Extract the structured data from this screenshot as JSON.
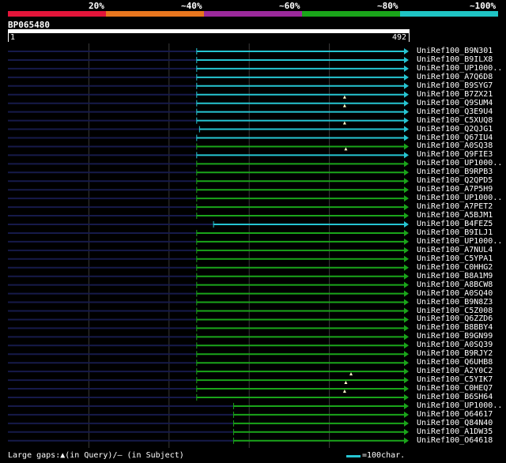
{
  "header": {
    "percent_labels": [
      "20%",
      "~40%",
      "~60%",
      "~80%",
      "~100%"
    ],
    "band_colors": [
      "#e3153a",
      "#e8761e",
      "#9c2a9c",
      "#1aa51a",
      "#1fc4c4"
    ]
  },
  "query": {
    "name": "BP065480",
    "start": "1",
    "end": "492"
  },
  "footer": {
    "gaps_text": "Large gaps:▲(in Query)/— (in Subject)",
    "scale_text": "=100char."
  },
  "colors": {
    "identity_high": "#26c5d2",
    "identity_med": "#1aa51a",
    "unaligned": "#161a4a",
    "grid": "#3a3a3a"
  },
  "hits": [
    {
      "id": "UniRef100_B9N301",
      "start": 0.471,
      "color": "cyan",
      "gap": null
    },
    {
      "id": "UniRef100_B9ILX8",
      "start": 0.471,
      "color": "cyan",
      "gap": null
    },
    {
      "id": "UniRef100_UP1000..",
      "start": 0.471,
      "color": "cyan",
      "gap": null
    },
    {
      "id": "UniRef100_A7Q6D8",
      "start": 0.471,
      "color": "cyan",
      "gap": null
    },
    {
      "id": "UniRef100_B9SYG7",
      "start": 0.471,
      "color": "cyan",
      "gap": null
    },
    {
      "id": "UniRef100_B7ZX21",
      "start": 0.471,
      "color": "cyan",
      "gap": null
    },
    {
      "id": "UniRef100_Q9SUM4",
      "start": 0.471,
      "color": "cyan",
      "gap": 0.84
    },
    {
      "id": "UniRef100_Q3E9U4",
      "start": 0.471,
      "color": "cyan",
      "gap": 0.84
    },
    {
      "id": "UniRef100_C5XUQ8",
      "start": 0.471,
      "color": "cyan",
      "gap": null
    },
    {
      "id": "UniRef100_Q2QJG1",
      "start": 0.478,
      "color": "cyan",
      "gap": 0.84
    },
    {
      "id": "UniRef100_Q67IU4",
      "start": 0.471,
      "color": "cyan",
      "gap": null
    },
    {
      "id": "UniRef100_A0SQ38",
      "start": 0.471,
      "color": "green",
      "gap": null
    },
    {
      "id": "UniRef100_Q9FIE3",
      "start": 0.471,
      "color": "cyan",
      "gap": 0.843
    },
    {
      "id": "UniRef100_UP1000..",
      "start": 0.471,
      "color": "green",
      "gap": null
    },
    {
      "id": "UniRef100_B9RPB3",
      "start": 0.471,
      "color": "green",
      "gap": null
    },
    {
      "id": "UniRef100_Q2QPD5",
      "start": 0.471,
      "color": "green",
      "gap": null
    },
    {
      "id": "UniRef100_A7P5H9",
      "start": 0.471,
      "color": "green",
      "gap": null
    },
    {
      "id": "UniRef100_UP1000..",
      "start": 0.471,
      "color": "green",
      "gap": null
    },
    {
      "id": "UniRef100_A7PET2",
      "start": 0.471,
      "color": "green",
      "gap": null
    },
    {
      "id": "UniRef100_A5BJM1",
      "start": 0.471,
      "color": "green",
      "gap": null
    },
    {
      "id": "UniRef100_B4FEZ5",
      "start": 0.513,
      "color": "cyan",
      "gap": null
    },
    {
      "id": "UniRef100_B9ILJ1",
      "start": 0.471,
      "color": "green",
      "gap": null
    },
    {
      "id": "UniRef100_UP1000..",
      "start": 0.471,
      "color": "green",
      "gap": null
    },
    {
      "id": "UniRef100_A7NUL4",
      "start": 0.471,
      "color": "green",
      "gap": null
    },
    {
      "id": "UniRef100_C5YPA1",
      "start": 0.471,
      "color": "green",
      "gap": null
    },
    {
      "id": "UniRef100_C0HHG2",
      "start": 0.471,
      "color": "green",
      "gap": null
    },
    {
      "id": "UniRef100_B8A1M9",
      "start": 0.471,
      "color": "green",
      "gap": null
    },
    {
      "id": "UniRef100_A8BCW8",
      "start": 0.471,
      "color": "green",
      "gap": null
    },
    {
      "id": "UniRef100_A0SQ40",
      "start": 0.471,
      "color": "green",
      "gap": null
    },
    {
      "id": "UniRef100_B9N8Z3",
      "start": 0.471,
      "color": "green",
      "gap": null
    },
    {
      "id": "UniRef100_C5Z008",
      "start": 0.471,
      "color": "green",
      "gap": null
    },
    {
      "id": "UniRef100_Q6ZZD6",
      "start": 0.471,
      "color": "green",
      "gap": null
    },
    {
      "id": "UniRef100_B8BBY4",
      "start": 0.471,
      "color": "green",
      "gap": null
    },
    {
      "id": "UniRef100_B9GN99",
      "start": 0.471,
      "color": "green",
      "gap": null
    },
    {
      "id": "UniRef100_A0SQ39",
      "start": 0.471,
      "color": "green",
      "gap": null
    },
    {
      "id": "UniRef100_B9RJY2",
      "start": 0.471,
      "color": "green",
      "gap": null
    },
    {
      "id": "UniRef100_Q6UHB8",
      "start": 0.471,
      "color": "green",
      "gap": null
    },
    {
      "id": "UniRef100_A2Y0C2",
      "start": 0.471,
      "color": "green",
      "gap": null
    },
    {
      "id": "UniRef100_C5YIK7",
      "start": 0.471,
      "color": "green",
      "gap": 0.856
    },
    {
      "id": "UniRef100_C0HEQ7",
      "start": 0.471,
      "color": "green",
      "gap": 0.843
    },
    {
      "id": "UniRef100_B6SH64",
      "start": 0.471,
      "color": "green",
      "gap": 0.84
    },
    {
      "id": "UniRef100_UP1000..",
      "start": 0.563,
      "color": "green",
      "gap": null
    },
    {
      "id": "UniRef100_O64617",
      "start": 0.563,
      "color": "green",
      "gap": null
    },
    {
      "id": "UniRef100_Q84N40",
      "start": 0.563,
      "color": "green",
      "gap": null
    },
    {
      "id": "UniRef100_A1DW35",
      "start": 0.563,
      "color": "green",
      "gap": null
    },
    {
      "id": "UniRef100_O64618",
      "start": 0.563,
      "color": "green",
      "gap": null
    }
  ]
}
